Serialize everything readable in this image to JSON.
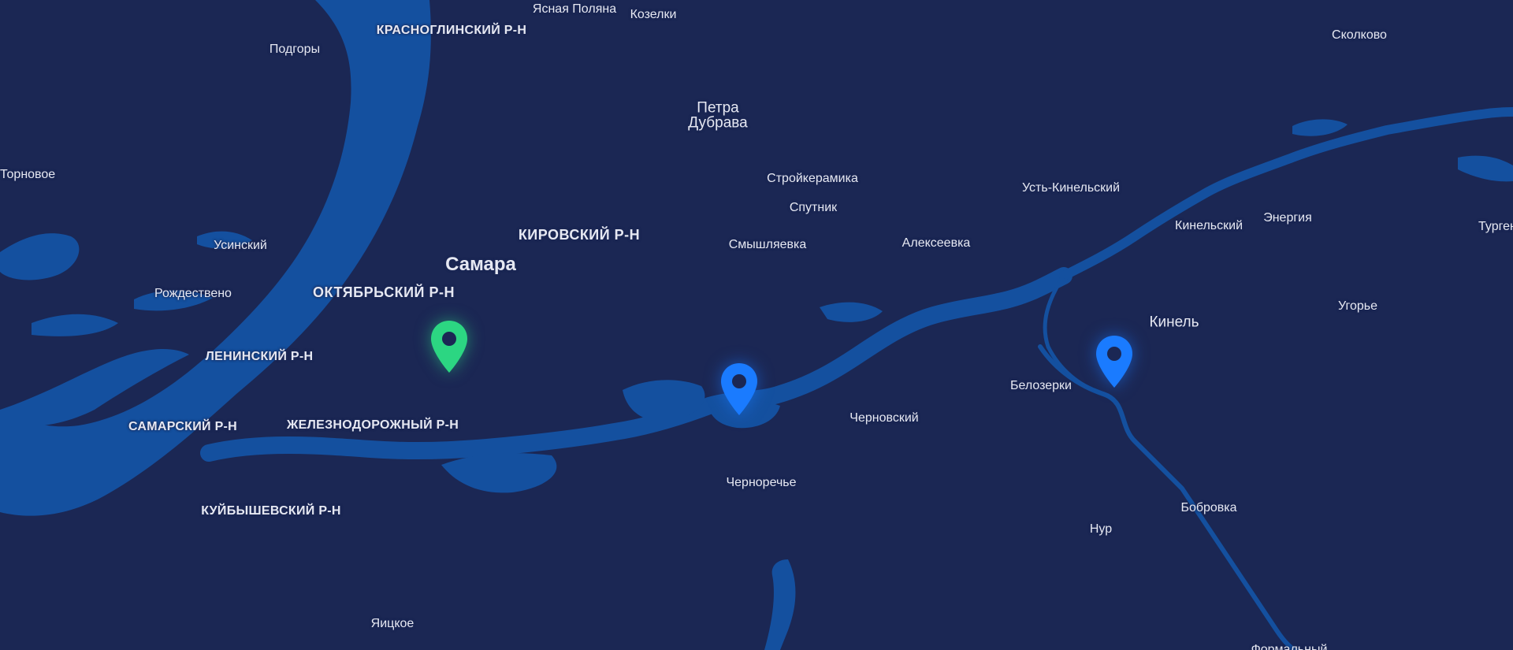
{
  "map": {
    "colors": {
      "background": "#1b2754",
      "water": "#14509f",
      "label_text": "#e6e8f2",
      "marker_green": "#2cd682",
      "marker_blue": "#1a7bff"
    },
    "city": "Самара",
    "districts": [
      "КРАСНОГЛИНСКИЙ Р-Н",
      "КИРОВСКИЙ Р-Н",
      "ОКТЯБРЬСКИЙ Р-Н",
      "ЛЕНИНСКИЙ Р-Н",
      "САМАРСКИЙ Р-Н",
      "ЖЕЛЕЗНОДОРОЖНЫЙ Р-Н",
      "КУЙБЫШЕВСКИЙ Р-Н"
    ],
    "places": [
      "Ясная Поляна",
      "Козелки",
      "Подгоры",
      "Сколково",
      "Петра",
      "Дубрава",
      "Торновое",
      "Стройкерамика",
      "Спутник",
      "Усть-Кинельский",
      "Кинельский",
      "Энергия",
      "Тургеневка",
      "Усинский",
      "Смышляевка",
      "Алексеевка",
      "Рождествено",
      "Угорье",
      "Белозерки",
      "Черновский",
      "Черноречье",
      "Бобровка",
      "Нур",
      "Яицкое",
      "Формальный"
    ],
    "town_kinel": "Кинель",
    "markers": [
      {
        "color": "green",
        "icon": "map-pin-icon"
      },
      {
        "color": "blue",
        "icon": "map-pin-icon"
      },
      {
        "color": "blue",
        "icon": "map-pin-icon"
      }
    ]
  }
}
